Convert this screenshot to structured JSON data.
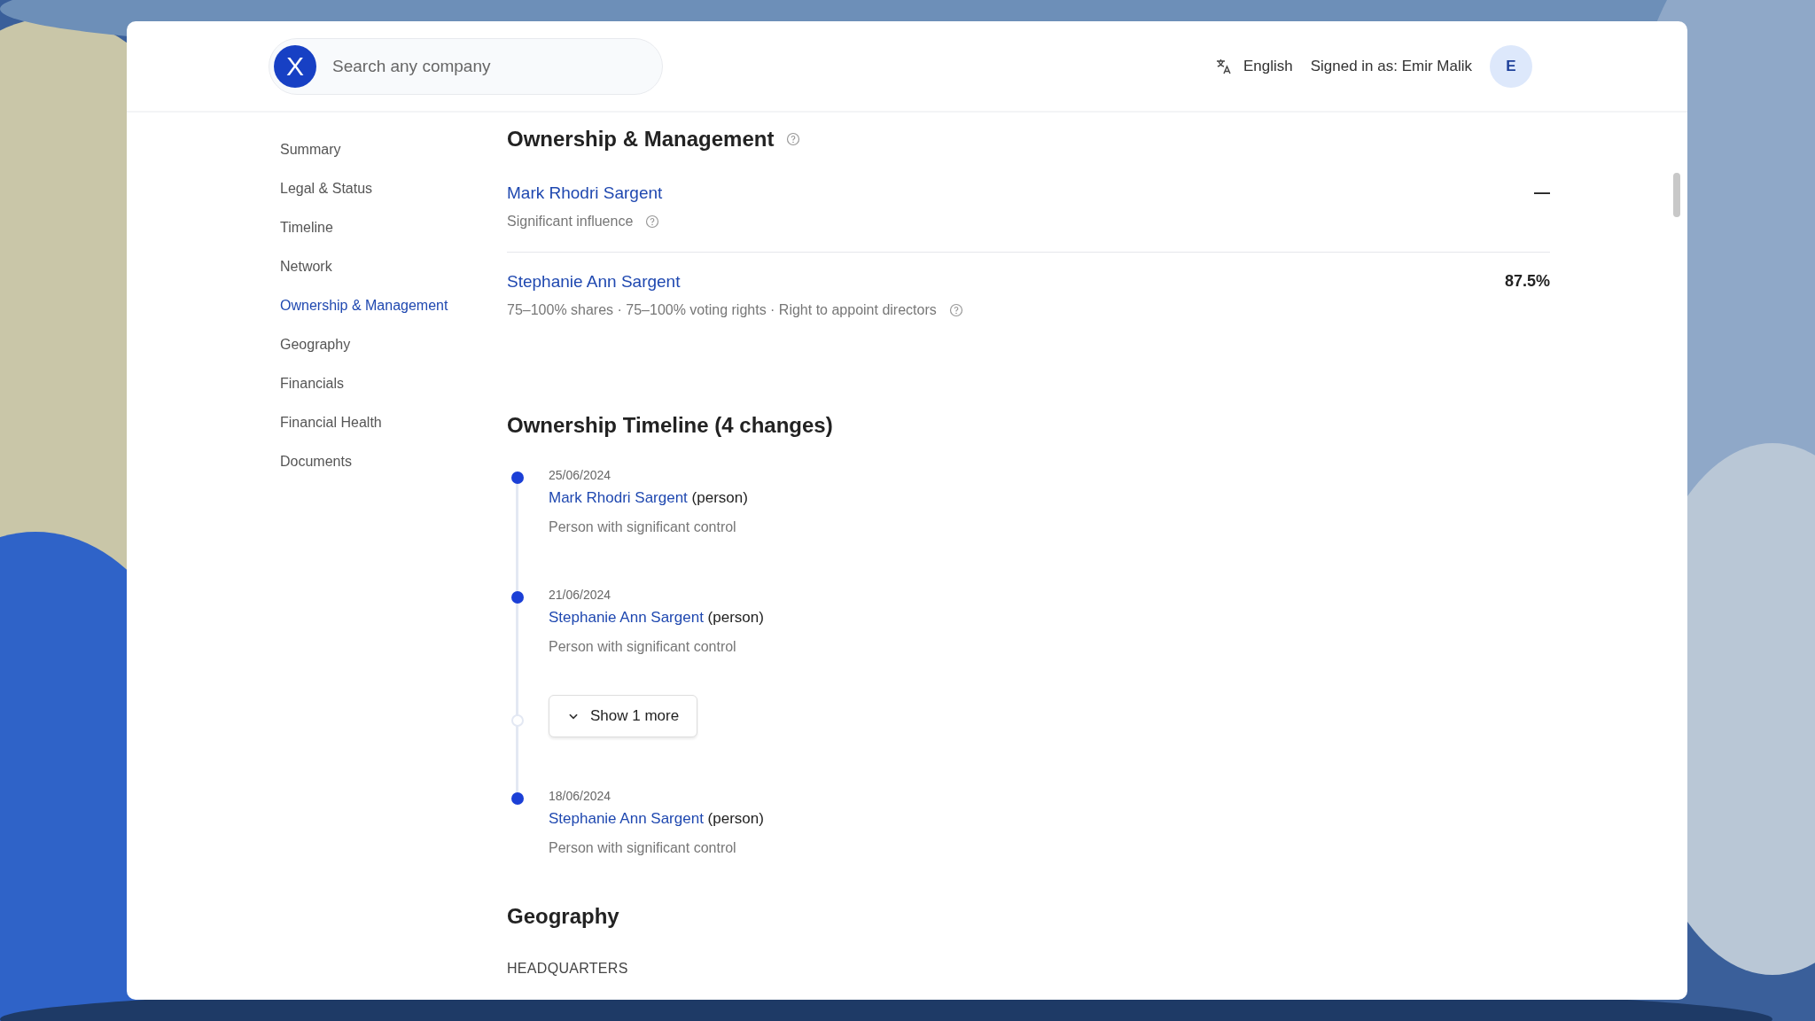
{
  "header": {
    "logo": "X",
    "search": {
      "placeholder": "Search any company"
    },
    "language": "English",
    "signed_in": "Signed in as: Emir Malik",
    "avatar": "E"
  },
  "sidebar": {
    "items": [
      {
        "label": "Summary",
        "selected": false
      },
      {
        "label": "Legal & Status",
        "selected": false
      },
      {
        "label": "Timeline",
        "selected": false
      },
      {
        "label": "Network",
        "selected": false
      },
      {
        "label": "Ownership & Management",
        "selected": true
      },
      {
        "label": "Geography",
        "selected": false
      },
      {
        "label": "Financials",
        "selected": false
      },
      {
        "label": "Financial Health",
        "selected": false
      },
      {
        "label": "Documents",
        "selected": false
      }
    ]
  },
  "ownership": {
    "title": "Ownership & Management",
    "owners": [
      {
        "name": "Mark Rhodri Sargent",
        "detail": "Significant influence",
        "value": "—"
      },
      {
        "name": "Stephanie Ann Sargent",
        "detail": "75–100% shares · 75–100% voting rights · Right to appoint directors",
        "value": "87.5%"
      }
    ]
  },
  "timeline": {
    "title": "Ownership Timeline (4 changes)",
    "entries": [
      {
        "kind": "event",
        "date": "25/06/2024",
        "name": "Mark Rhodri Sargent",
        "type": "(person)",
        "description": "Person with significant control"
      },
      {
        "kind": "event",
        "date": "21/06/2024",
        "name": "Stephanie Ann Sargent",
        "type": "(person)",
        "description": "Person with significant control"
      },
      {
        "kind": "more",
        "label": "Show 1 more"
      },
      {
        "kind": "event",
        "date": "18/06/2024",
        "name": "Stephanie Ann Sargent",
        "type": "(person)",
        "description": "Person with significant control"
      }
    ]
  },
  "geography": {
    "title": "Geography",
    "subtitle": "HEADQUARTERS"
  }
}
